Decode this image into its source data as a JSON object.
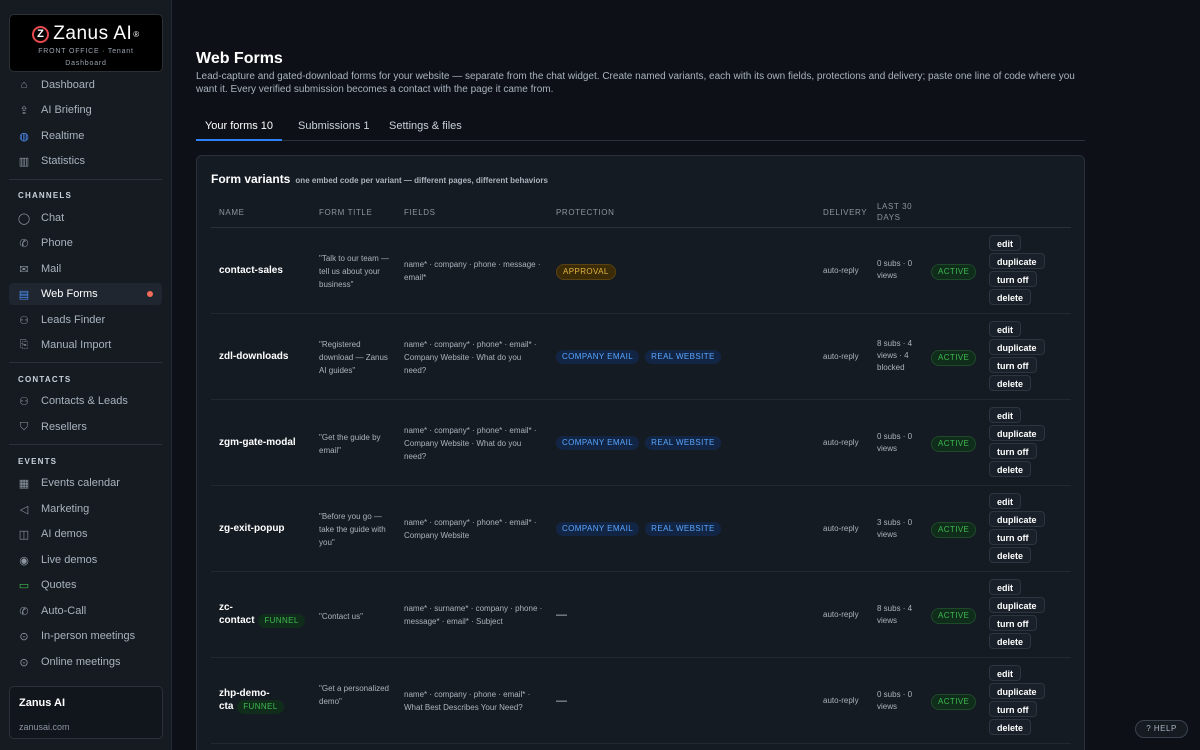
{
  "brand": {
    "name": "Zanus AI",
    "reg": "®",
    "line1": "FRONT OFFICE · Tenant",
    "line2": "Dashboard"
  },
  "nav": {
    "top": [
      "Dashboard",
      "AI Briefing",
      "Realtime",
      "Statistics"
    ],
    "channels_label": "CHANNELS",
    "channels": [
      "Chat",
      "Phone",
      "Mail",
      "Web Forms",
      "Leads Finder",
      "Manual Import"
    ],
    "contacts_label": "CONTACTS",
    "contacts": [
      "Contacts & Leads",
      "Resellers"
    ],
    "events_label": "EVENTS",
    "events": [
      "Events calendar",
      "Marketing",
      "AI demos",
      "Live demos",
      "Quotes",
      "Auto-Call",
      "In-person meetings",
      "Online meetings"
    ]
  },
  "tenant": {
    "name": "Zanus AI",
    "url": "zanusai.com"
  },
  "page": {
    "title": "Web Forms",
    "description": "Lead-capture and gated-download forms for your website — separate from the chat widget. Create named variants, each with its own fields, protections and delivery; paste one line of code where you want it. Every verified submission becomes a contact with the page it came from."
  },
  "tabs": [
    "Your forms 10",
    "Submissions 1",
    "Settings & files"
  ],
  "card": {
    "title": "Form variants",
    "subtitle": "one embed code per variant — different pages, different behaviors"
  },
  "columns": [
    "NAME",
    "FORM TITLE",
    "FIELDS",
    "PROTECTION",
    "DELIVERY",
    "LAST 30 DAYS"
  ],
  "actions": [
    "edit",
    "duplicate",
    "turn off",
    "delete"
  ],
  "rows": [
    {
      "name": "contact-sales",
      "tag": "",
      "title": "\"Talk to our team — tell us about your business\"",
      "fields": "name* · company · phone · message · email*",
      "protection": [
        "APPROVAL"
      ],
      "delivery": "auto-reply",
      "stats": "0 subs · 0 views",
      "status": "ACTIVE"
    },
    {
      "name": "zdl-downloads",
      "tag": "",
      "title": "\"Registered download — Zanus AI guides\"",
      "fields": "name* · company* · phone* · email* · Company Website · What do you need?",
      "protection": [
        "COMPANY EMAIL",
        "REAL WEBSITE"
      ],
      "delivery": "auto-reply",
      "stats": "8 subs · 4 views · 4 blocked",
      "status": "ACTIVE"
    },
    {
      "name": "zgm-gate-modal",
      "tag": "",
      "title": "\"Get the guide by email\"",
      "fields": "name* · company* · phone* · email* · Company Website · What do you need?",
      "protection": [
        "COMPANY EMAIL",
        "REAL WEBSITE"
      ],
      "delivery": "auto-reply",
      "stats": "0 subs · 0 views",
      "status": "ACTIVE"
    },
    {
      "name": "zg-exit-popup",
      "tag": "",
      "title": "\"Before you go — take the guide with you\"",
      "fields": "name* · company* · phone* · email* · Company Website",
      "protection": [
        "COMPANY EMAIL",
        "REAL WEBSITE"
      ],
      "delivery": "auto-reply",
      "stats": "3 subs · 0 views",
      "status": "ACTIVE"
    },
    {
      "name_line1": "zc-",
      "name_line2": "contact",
      "tag": "FUNNEL",
      "title": "\"Contact us\"",
      "fields": "name* · surname* · company · phone · message* · email* · Subject",
      "protection": [],
      "protection_empty": "—",
      "delivery": "auto-reply",
      "stats": "8 subs · 4 views",
      "status": "ACTIVE"
    },
    {
      "name_line1": "zhp-demo-",
      "name_line2": "cta",
      "tag": "FUNNEL",
      "title": "\"Get a personalized demo\"",
      "fields": "name* · company · phone · email* · What Best Describes Your Need?",
      "protection": [],
      "protection_empty": "—",
      "delivery": "auto-reply",
      "stats": "0 subs · 0 views",
      "status": "ACTIVE"
    }
  ],
  "help": "? HELP"
}
